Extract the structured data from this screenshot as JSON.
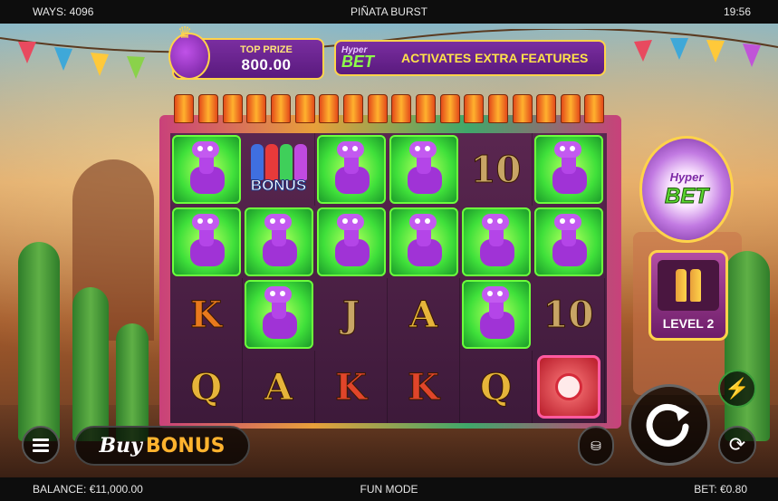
{
  "topbar": {
    "ways": "WAYS: 4096",
    "title": "PIÑATA BURST",
    "time": "19:56"
  },
  "bottombar": {
    "balance": "BALANCE: €11,000.00",
    "mode": "FUN MODE",
    "bet": "BET: €0.80"
  },
  "top_prize": {
    "label": "TOP PRIZE",
    "value": "800.00"
  },
  "hyper_banner": {
    "logo_top": "Hyper",
    "logo_main": "BET",
    "text": "ACTIVATES EXTRA FEATURES"
  },
  "hyper_bet": {
    "logo_top": "Hyper",
    "logo_main": "BET",
    "level": "LEVEL 2"
  },
  "buy_bonus": {
    "buy": "Buy",
    "bonus": "BONUS"
  },
  "reels": [
    [
      "llama",
      "llama",
      "K",
      "Q"
    ],
    [
      "bonus",
      "llama",
      "llama",
      "A"
    ],
    [
      "llama",
      "llama",
      "J",
      "K"
    ],
    [
      "llama",
      "llama",
      "A",
      "K"
    ],
    [
      "10",
      "llama",
      "llama",
      "Q"
    ],
    [
      "llama",
      "llama",
      "10",
      "candy"
    ]
  ],
  "bonus_label": "BONUS",
  "icons": {
    "menu": "hamburger-icon",
    "stake": "coin-stack-icon",
    "spin": "spin-arrow-icon",
    "turbo": "lightning-icon",
    "autoplay": "autoplay-icon"
  },
  "colors": {
    "llama_bg": "#3fe03a",
    "frame_gold": "#ffd34a",
    "panel_purple": "#7a2ea0"
  }
}
